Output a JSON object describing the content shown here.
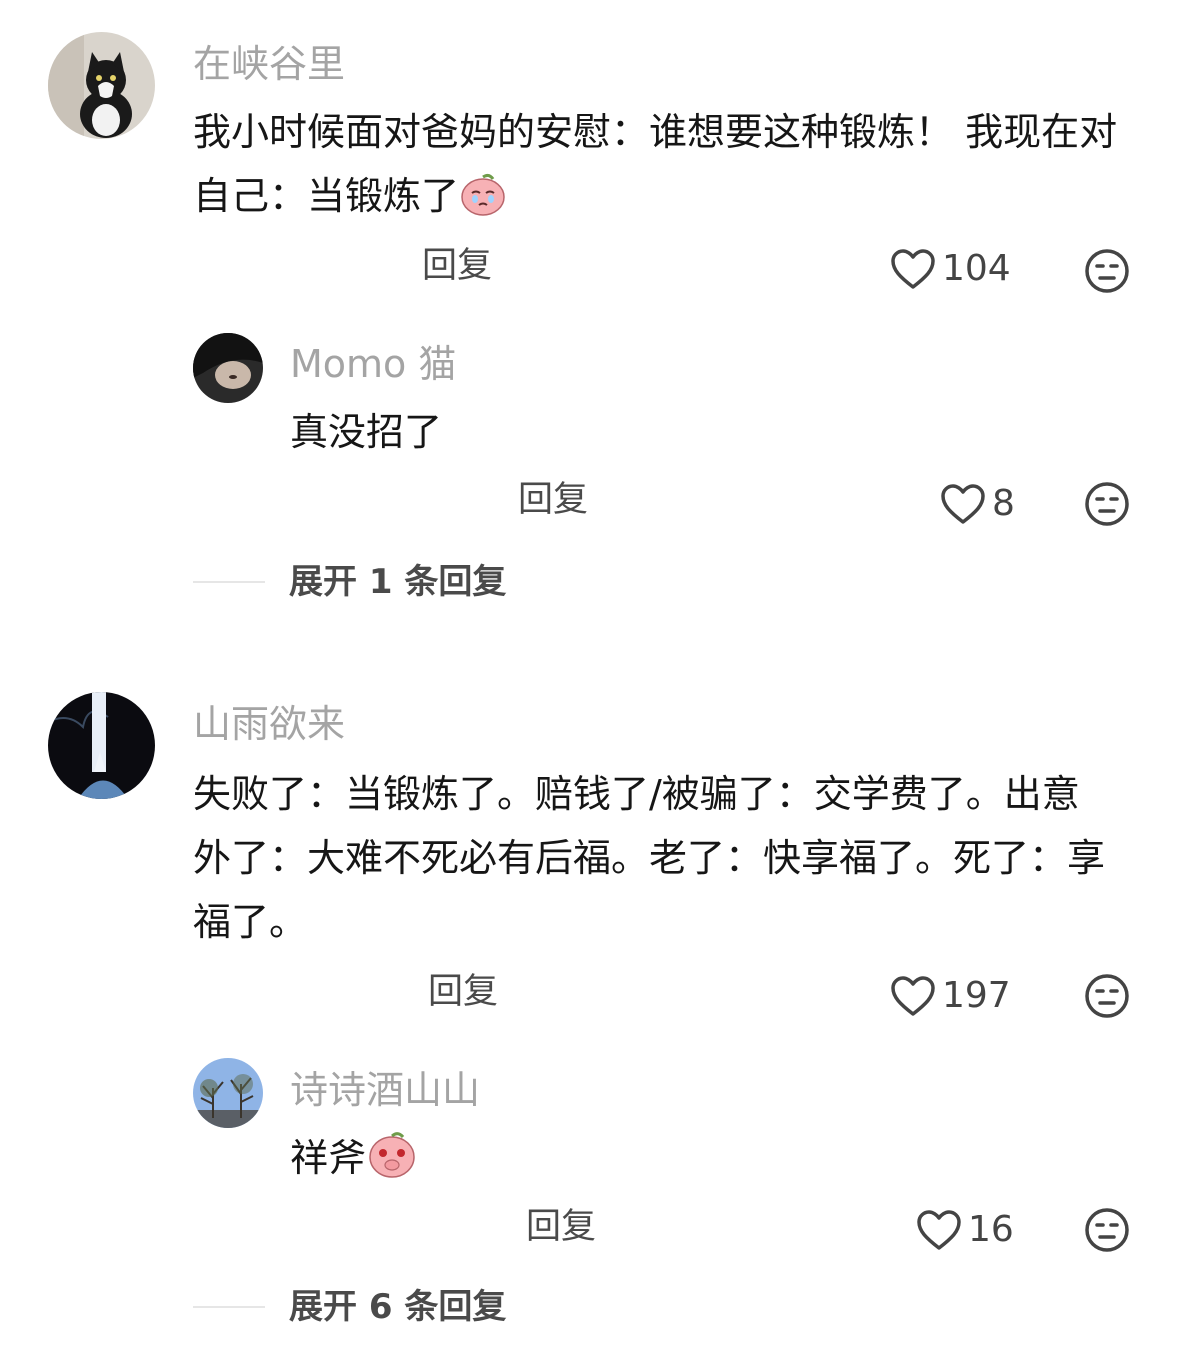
{
  "comments": [
    {
      "username": "在峡谷里",
      "text": "我小时候面对爸妈的安慰：谁想要这种锻炼！ 我现在对自己：当锻炼了",
      "emoji": "crying-peach-emoji",
      "reply_label": "回复",
      "likes": "104",
      "replies": [
        {
          "username": "Momo 猫",
          "text": "真没招了",
          "reply_label": "回复",
          "likes": "8"
        }
      ],
      "expand_label": "展开 1 条回复"
    },
    {
      "username": "山雨欲来",
      "text": "失败了：当锻炼了。赔钱了/被骗了：交学费了。出意外了：大难不死必有后福。老了：快享福了。死了：享福了。",
      "reply_label": "回复",
      "likes": "197",
      "replies": [
        {
          "username": "诗诗酒山山",
          "text": "祥斧",
          "emoji": "peach-snicker-emoji",
          "reply_label": "回复",
          "likes": "16"
        }
      ],
      "expand_label": "展开 6 条回复"
    }
  ],
  "icons": {
    "like": "heart-outline-icon",
    "dislike": "unamused-face-icon"
  },
  "colors": {
    "username": "#a4a4a4",
    "text": "#161616",
    "secondary": "#4a4a4a"
  }
}
